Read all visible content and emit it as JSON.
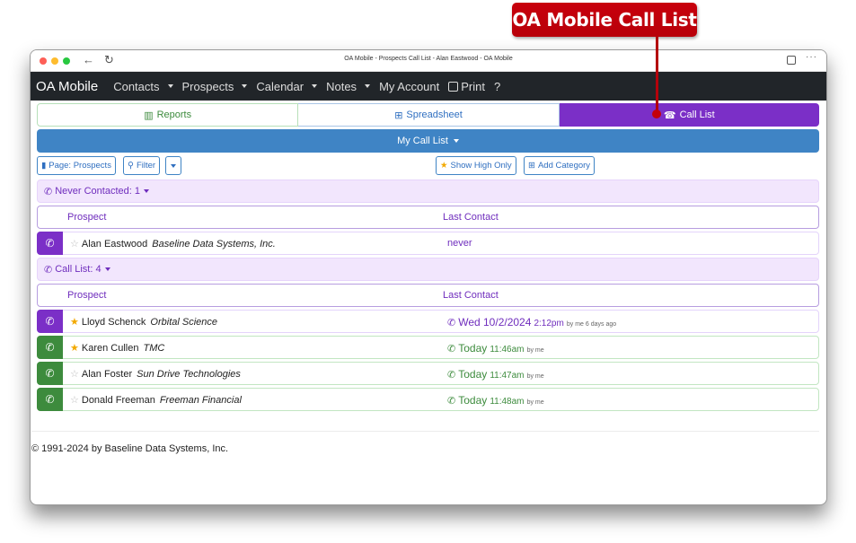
{
  "callout": {
    "label": "OA Mobile Call List"
  },
  "window": {
    "title": "OA Mobile - Prospects Call List - Alan Eastwood - OA Mobile",
    "icons": {
      "back": "←",
      "reload": "↻",
      "more": "···"
    }
  },
  "navbar": {
    "brand": "OA Mobile",
    "items": [
      {
        "label": "Contacts",
        "dropdown": true
      },
      {
        "label": "Prospects",
        "dropdown": true
      },
      {
        "label": "Calendar",
        "dropdown": true
      },
      {
        "label": "Notes",
        "dropdown": true
      },
      {
        "label": "My Account",
        "dropdown": false
      },
      {
        "label": "Print",
        "dropdown": false
      },
      {
        "label": "?",
        "dropdown": false
      }
    ]
  },
  "tabs": [
    {
      "label": "Reports",
      "icon": "📊",
      "active": false
    },
    {
      "label": "Spreadsheet",
      "icon": "⊞",
      "active": false
    },
    {
      "label": "Call List",
      "icon": "☎",
      "active": true
    }
  ],
  "colors": {
    "accent_purple": "#7b2fc7",
    "accent_blue": "#3f84c5",
    "accent_green": "#3d8b3d",
    "callout_red": "#c8000c"
  },
  "call_list_selector": {
    "label": "My Call List"
  },
  "toolbar": {
    "page_label": "Page: Prospects",
    "filter_label": "Filter",
    "show_high_label": "Show High Only",
    "add_category_label": "Add Category"
  },
  "groups": [
    {
      "header": "Never Contacted: 1",
      "col_prospect": "Prospect",
      "col_last_contact": "Last Contact",
      "rows": [
        {
          "name": "Alan Eastwood",
          "company": "Baseline Data Systems, Inc.",
          "high": false,
          "last_contact": "never"
        }
      ]
    },
    {
      "header": "Call List: 4",
      "col_prospect": "Prospect",
      "col_last_contact": "Last Contact",
      "rows": [
        {
          "name": "Lloyd Schenck",
          "company": "Orbital Science",
          "high": true,
          "date": "Wed 10/2/2024",
          "time": "2:12pm",
          "by": "by me 6 days ago"
        },
        {
          "name": "Karen Cullen",
          "company": "TMC",
          "high": true,
          "date": "Today",
          "time": "11:46am",
          "by": "by me"
        },
        {
          "name": "Alan Foster",
          "company": "Sun Drive Technologies",
          "high": false,
          "date": "Today",
          "time": "11:47am",
          "by": "by me"
        },
        {
          "name": "Donald Freeman",
          "company": "Freeman Financial",
          "high": false,
          "date": "Today",
          "time": "11:48am",
          "by": "by me"
        }
      ]
    }
  ],
  "footer": {
    "copyright": "© 1991-2024 by Baseline Data Systems, Inc."
  }
}
